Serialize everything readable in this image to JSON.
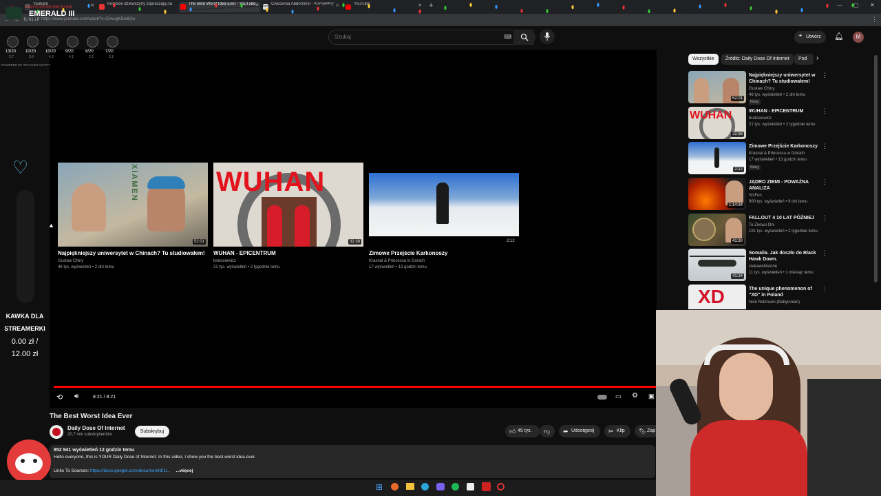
{
  "tabs": [
    {
      "label": "Youtube",
      "active": false
    },
    {
      "label": "Kirgiskie dziewczyny zapraszają na",
      "active": false
    },
    {
      "label": "The Best Worst Idea Ever - YouTube",
      "active": true
    },
    {
      "label": "Ćwiczenia Abdominal - Kompletny",
      "active": false
    },
    {
      "label": "YouTube",
      "active": false
    }
  ],
  "overlay_stream": {
    "streamer": "MANTOGSSEUNE EUNE",
    "rank": "EMERALD III",
    "lp": "61 LP",
    "stat_ratios": [
      "13/20",
      "10/20",
      "10/20",
      "9/20",
      "8/20",
      "7/20"
    ],
    "stat_avgs": [
      "3.7",
      "3.6",
      "4.2",
      "4.1",
      "2.2",
      "3.1"
    ],
    "powered_by": "POWERED BY TRACKER.GG/TFT",
    "donation_line1": "KAWKA DLA",
    "donation_line2": "STREAMERKI",
    "donation_amount": "0.00 zł /",
    "donation_goal": "12.00 zł"
  },
  "address_bar": {
    "url": "https://www.youtube.com/watch?v=ZvwugKDw6Qw"
  },
  "header": {
    "search_placeholder": "Szukaj",
    "create_label": "Utwórz",
    "avatar_letter": "M"
  },
  "endscreen": {
    "cards": [
      {
        "title": "Najpiękniejszy uniwersytet w Chinach? Tu studiowałem!",
        "channel": "Gustaw Chiny",
        "meta": "46 tys. wyświetleń • 2 dni temu",
        "duration": "52:01",
        "thumb_text": "XIAMEN"
      },
      {
        "title": "WUHAN - EPICENTRUM",
        "channel": "bratosiewicz",
        "meta": "21 tys. wyświetleń • 2 tygodnie temu",
        "duration": "32:38",
        "thumb_text": "WUHAN"
      },
      {
        "title": "Zimowe Przejście Karkonoszy",
        "channel": "Krasnal & Princessa w Górach",
        "meta": "17 wyświetleń • 13 godzin temu",
        "duration": "2:12",
        "thumb_text": ""
      }
    ]
  },
  "player_controls": {
    "time": "8:21 / 8:21",
    "progress": 1.0
  },
  "video": {
    "title": "The Best Worst Idea Ever",
    "channel": "Daily Dose Of Internet",
    "subscribers": "20,7 mln subskrybentów",
    "subscribe_label": "Subskrybuj",
    "likes": "45 tys.",
    "share_label": "Udostępnij",
    "clip_label": "Klip",
    "save_label": "Zap",
    "views_date": "852 941 wyświetleń  12 godzin temu",
    "description": "Hello everyone, this is YOUR Daily Dose of Internet. In this video, I show you the best worst idea ever.",
    "links_label": "Links To Sources:",
    "links_url": "https://docs.google.com/document/d/1i...",
    "more_label": "...więcej"
  },
  "sidebar": {
    "chips": [
      "Wszystkie",
      "Źródło: Daily Dose Of Internet",
      "Pod"
    ],
    "recommendations": [
      {
        "title": "Najpiękniejszy uniwersytet w Chinach? Tu studiowałem!",
        "channel": "Gustaw Chiny",
        "meta": "46 tys. wyświetleń • 2 dni temu",
        "badge": "Nowy",
        "duration": "52:01"
      },
      {
        "title": "WUHAN - EPICENTRUM",
        "channel": "bratosiewicz",
        "meta": "21 tys. wyświetleń • 2 tygodnie temu",
        "badge": "",
        "duration": "32:38"
      },
      {
        "title": "Zimowe Przejście Karkonoszy",
        "channel": "Krasnal & Princessa w Górach",
        "meta": "17 wyświetleń • 13 godzin temu",
        "badge": "Nowy",
        "duration": "2:12"
      },
      {
        "title": "JĄDRO ZIEMI - POWAŻNA ANALIZA",
        "channel": "SciFun",
        "meta": "900 tys. wyświetleń • 9 dni temu",
        "badge": "",
        "duration": "1:14:34"
      },
      {
        "title": "FALLOUT 4 10 LAT PÓŹNIEJ",
        "channel": "To Znowu Oni",
        "meta": "191 tys. wyświetleń • 2 tygodnie temu",
        "badge": "",
        "duration": "41:30"
      },
      {
        "title": "Somalia. Jak doszło do Black Hawk Down.",
        "channel": "ciekawehistorie",
        "meta": "11 tys. wyświetleń • 1 miesiąc temu",
        "badge": "",
        "duration": "41:34"
      },
      {
        "title": "The unique phenomenon of \"XD\" in Poland",
        "channel": "Nick Robinson (Babylonian)",
        "meta": "",
        "badge": "",
        "duration": ""
      }
    ]
  },
  "colors": {
    "accent_red": "#ff0000",
    "bg": "#0f0f0f",
    "chip_bg": "#272727"
  }
}
